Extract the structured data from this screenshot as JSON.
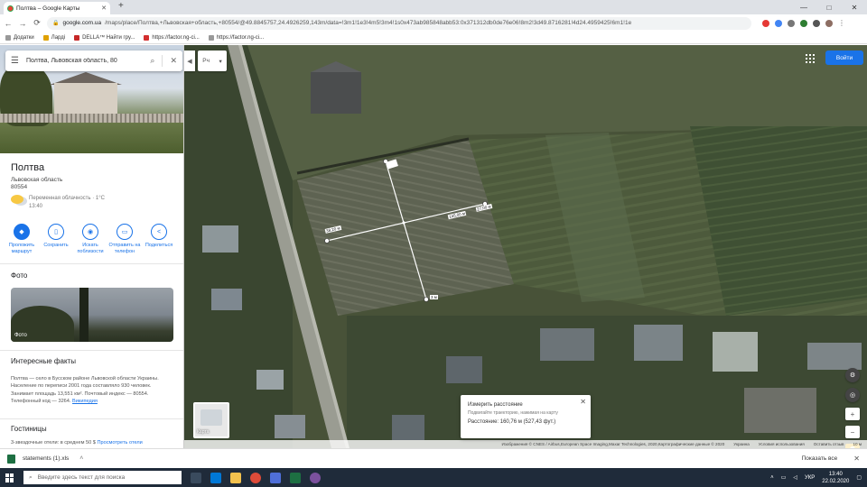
{
  "browser": {
    "tab_title": "Полтва – Google Карты",
    "new_tab": "+",
    "url_host": "google.com.ua",
    "url_path": "/maps/place/Полтва,+Львовская+область,+80554/@49.8845757,24.4926259,143m/data=!3m1!1e3!4m5!3m4!1s0x473ab985848abb53:0x371312db0de76e06!8m2!3d49.8716281!4d24.4959425!6m1!1e",
    "minimize": "—",
    "maximize": "□",
    "close": "✕"
  },
  "bookmarks": [
    {
      "label": "Додатки"
    },
    {
      "label": "Ларді"
    },
    {
      "label": "DELLA™ Найти гру..."
    },
    {
      "label": "https://factor.ng-ci..."
    },
    {
      "label": "https://factor.ng-ci..."
    }
  ],
  "panel": {
    "search_value": "Полтва, Львовская область, 80",
    "title": "Полтва",
    "region": "Львовская область",
    "zip": "80554",
    "weather_desc": "Переменная облачность · 1°C",
    "weather_time": "13:40",
    "actions": [
      {
        "label": "Проложить маршрут",
        "icon": "◆"
      },
      {
        "label": "Сохранить",
        "icon": "▯"
      },
      {
        "label": "Искать поблизости",
        "icon": "◉"
      },
      {
        "label": "Отправить на телефон",
        "icon": "▭"
      },
      {
        "label": "Поделиться",
        "icon": "<"
      }
    ],
    "photos_heading": "Фото",
    "photo_label": "Фото",
    "facts_heading": "Интересные факты",
    "facts_text": "Полтва — село в Бусском районе Львовской области Украины. Население по переписи 2001 года составляло 930 человек. Занимает площадь 13,551 км². Почтовый индекс — 80554. Телефонный код — 3264.",
    "facts_link": "Википедия",
    "hotels_heading": "Гостиницы",
    "hotels_text": "3-звездочные отели: в среднем 50 $",
    "hotels_link": "Просмотреть отели"
  },
  "map": {
    "layer_label": "Рч",
    "signin_label": "Войти",
    "minimap_label": "Карта",
    "measure": {
      "title": "Измерить расстояние",
      "hint": "Подвигайте траекторию, нажимая на карту",
      "distance": "Расстояние: 160,76 м (527,43 фут.)"
    },
    "line_labels": [
      "38,20 м",
      "145,00 м",
      "27,00 м",
      "3 м"
    ],
    "footer": [
      "Изображения © CNES / Airbus,European Space Imaging,Maxar Technologies, 2020,Картографические данные © 2020",
      "Украина",
      "Условия использования",
      "Оставить отзыв",
      "10 м"
    ],
    "zoom_in": "+",
    "zoom_out": "−"
  },
  "downloads": {
    "file": "statements (1).xls",
    "show_all": "Показать все"
  },
  "taskbar": {
    "search_placeholder": "Введите здесь текст для поиска",
    "lang": "УКР",
    "time": "13:40",
    "date": "22.02.2020"
  }
}
